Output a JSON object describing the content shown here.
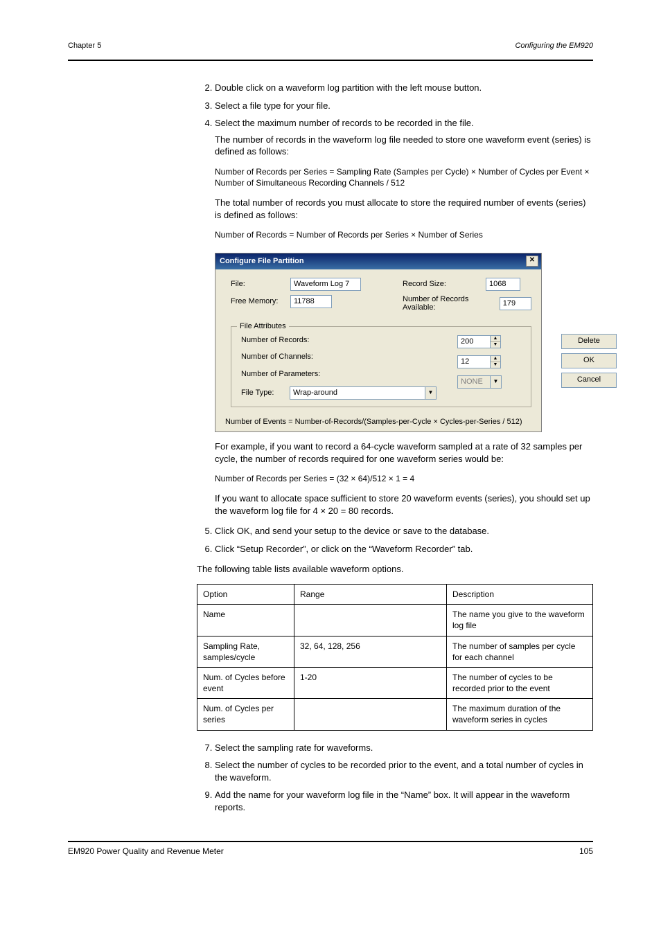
{
  "header": {
    "left": "Chapter 5",
    "right": "Configuring the EM920",
    "page_num_top": ""
  },
  "footer": {
    "left": "EM920 Power Quality and Revenue Meter",
    "right": "105"
  },
  "steps": [
    {
      "n": "2",
      "text": "Double click on a waveform log partition with the left mouse button."
    },
    {
      "n": "3",
      "text": "Select a file type for your file."
    },
    {
      "n": "4",
      "text": "Select the maximum number of records to be recorded in the file.",
      "sub": "The number of records in the waveform log file needed to store one waveform event (series) is defined as follows:"
    }
  ],
  "formula1": "Number of Records per Series = Sampling Rate (Samples per Cycle) × Number of Cycles per Event × Number of Simultaneous Recording Channels / 512",
  "para_after_formula1": "The total number of records you must allocate to store the required number of events (series) is defined as follows:",
  "formula2": "Number of Records = Number of Records per Series × Number of Series",
  "dlg": {
    "title": "Configure File Partition",
    "file_label": "File:",
    "file_value": "Waveform Log 7",
    "freemem_label": "Free Memory:",
    "freemem_value": "11788",
    "recsize_label": "Record Size:",
    "recsize_value": "1068",
    "avail_label": "Number of Records Available:",
    "avail_value": "179",
    "group_label": "File Attributes",
    "numrec_label": "Number of Records:",
    "numrec_value": "200",
    "numch_label": "Number of Channels:",
    "numch_value": "12",
    "numparam_label": "Number of Parameters:",
    "numparam_value": "NONE",
    "filetype_label": "File Type:",
    "filetype_value": "Wrap-around",
    "btn_delete": "Delete",
    "btn_ok": "OK",
    "btn_cancel": "Cancel",
    "footer_note": "Number of Events = Number-of-Records/(Samples-per-Cycle × Cycles-per-Series / 512)"
  },
  "after_dlg_para1": "For example, if you want to record a 64-cycle waveform sampled at a rate of 32 samples per cycle, the number of records required for one waveform series would be:",
  "calc_line": "Number of Records per Series = (32 × 64)/512 × 1 = 4",
  "after_dlg_para2": "If you want to allocate space sufficient to store 20 waveform events (series), you should set up the waveform log file for 4 × 20 = 80 records.",
  "step5": "Click OK, and send your setup to the device or save to the database.",
  "step6": "Click “Setup Recorder”, or click on the “Waveform Recorder” tab.",
  "table_intro": "The following table lists available waveform options.",
  "table": {
    "header": [
      "Option",
      "Range",
      "Description"
    ],
    "rows": [
      [
        "Name",
        "",
        "The name you give to the waveform log file"
      ],
      [
        "Sampling Rate, samples/cycle",
        "32, 64, 128, 256",
        "The number of samples per cycle for each channel"
      ],
      [
        "Num. of Cycles before event",
        "1-20",
        "The number of cycles to be recorded prior to the event"
      ],
      [
        "Num. of Cycles per series",
        "",
        "The maximum duration of the waveform series in cycles"
      ]
    ]
  },
  "step7": "Select the sampling rate for waveforms.",
  "step8": "Select the number of cycles to be recorded prior to the event, and a total number of cycles in the waveform.",
  "step9": "Add the name for your waveform log file in the “Name” box. It will appear in the waveform reports."
}
